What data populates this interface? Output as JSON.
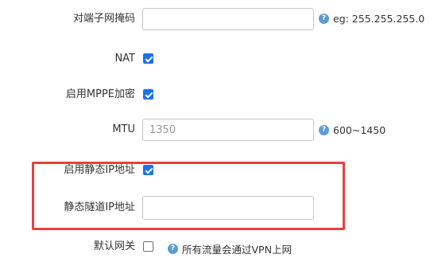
{
  "form": {
    "peer_netmask": {
      "label": "对端子网掩码",
      "value": "",
      "hint": "eg: 255.255.255.0",
      "icon": "help-icon"
    },
    "nat": {
      "label": "NAT",
      "checked": true
    },
    "mppe": {
      "label": "启用MPPE加密",
      "checked": true
    },
    "mtu": {
      "label": "MTU",
      "placeholder": "1350",
      "value": "",
      "hint": "600~1450",
      "icon": "help-icon"
    },
    "static_ip": {
      "label": "启用静态IP地址",
      "checked": true
    },
    "static_tunnel_ip": {
      "label": "静态隧道IP地址",
      "value": ""
    },
    "default_gateway": {
      "label": "默认网关",
      "checked": false,
      "hint": "所有流量会通过VPN上网",
      "icon": "help-icon"
    }
  },
  "colors": {
    "accent": "#1a73e8",
    "highlight_border": "#e8403f",
    "help_icon": "#5b9bd5"
  }
}
